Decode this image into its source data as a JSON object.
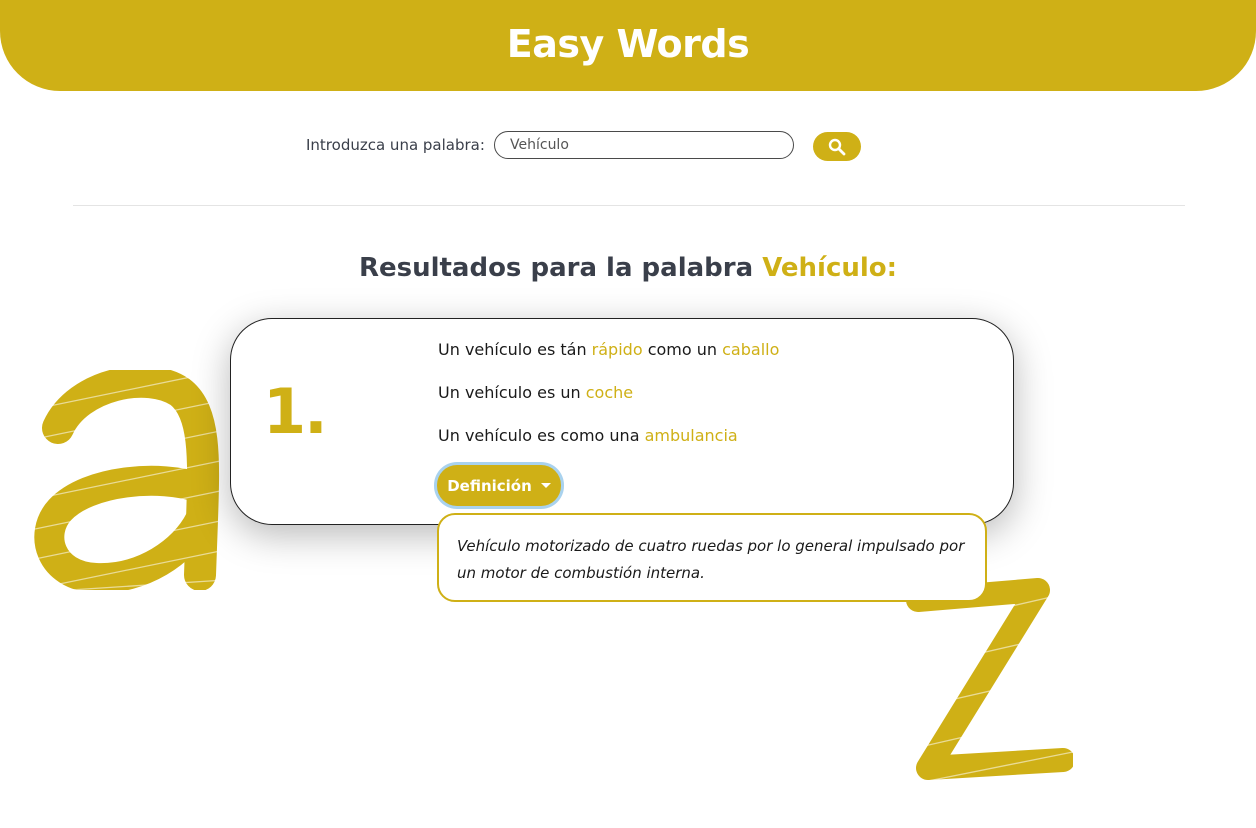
{
  "header": {
    "title": "Easy Words"
  },
  "search": {
    "label": "Introduzca una palabra:",
    "value": "Vehículo",
    "button_icon": "search-icon"
  },
  "results": {
    "title_prefix": "Resultados para la palabra",
    "title_word": "Vehículo:"
  },
  "card": {
    "number": "1.",
    "examples": [
      {
        "prefix": "Un vehículo es tán",
        "word1": "rápido",
        "middle": "como un",
        "word2": "caballo"
      },
      {
        "prefix": "Un vehículo es un",
        "word1": "coche"
      },
      {
        "prefix": "Un vehículo es como una",
        "word1": "ambulancia"
      }
    ],
    "definition_button": "Definición",
    "definition_text": "Vehículo motorizado de cuatro ruedas por lo general impulsado por un motor de combustión interna."
  },
  "decorations": {
    "letter_left": "a",
    "letter_right": "z"
  },
  "colors": {
    "accent": "#cfb016",
    "text": "#3a3f4a",
    "focus_ring": "#a9d2ee"
  }
}
